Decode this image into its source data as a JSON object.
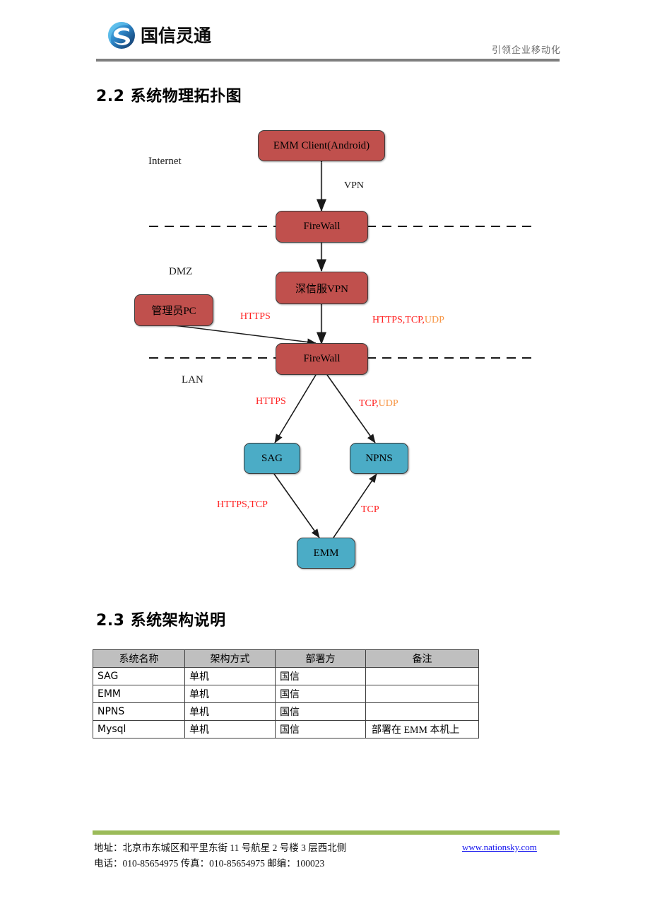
{
  "header": {
    "logo_text": "国信灵通",
    "logo_icon": "nationsky-swirl-logo-icon",
    "slogan": "引领企业移动化"
  },
  "sections": {
    "topology_heading": "2.2  系统物理拓扑图",
    "architecture_heading": "2.3  系统架构说明"
  },
  "diagram": {
    "nodes": [
      {
        "id": "emm-client",
        "label": "EMM Client(Android)",
        "color": "#c0504d"
      },
      {
        "id": "firewall-top",
        "label": "FireWall",
        "color": "#c0504d"
      },
      {
        "id": "sangfor-vpn",
        "label": "深信服VPN",
        "color": "#c0504d"
      },
      {
        "id": "admin-pc",
        "label": "管理员PC",
        "color": "#c0504d"
      },
      {
        "id": "firewall-bottom",
        "label": "FireWall",
        "color": "#c0504d"
      },
      {
        "id": "sag",
        "label": "SAG",
        "color": "#4bacc6"
      },
      {
        "id": "npns",
        "label": "NPNS",
        "color": "#4bacc6"
      },
      {
        "id": "emm",
        "label": "EMM",
        "color": "#4bacc6"
      }
    ],
    "zones": [
      {
        "id": "internet",
        "label": "Internet"
      },
      {
        "id": "dmz",
        "label": "DMZ"
      },
      {
        "id": "lan",
        "label": "LAN"
      }
    ],
    "edge_labels": [
      {
        "id": "vpn",
        "text": "VPN",
        "color": "#1a1a1a"
      },
      {
        "id": "https-admin",
        "text": "HTTPS",
        "color": "#ff2020"
      },
      {
        "id": "https-tcp",
        "text": "HTTPS,TCP,",
        "color": "#ff2020"
      },
      {
        "id": "udp-suffix-1",
        "text": "UDP",
        "color": "#f79646"
      },
      {
        "id": "https-sag",
        "text": "HTTPS",
        "color": "#ff2020"
      },
      {
        "id": "tcp-npns",
        "text": "TCP,",
        "color": "#ff2020"
      },
      {
        "id": "udp-suffix-2",
        "text": "UDP",
        "color": "#f79646"
      },
      {
        "id": "https-tcp-emm",
        "text": "HTTPS,TCP",
        "color": "#ff2020"
      },
      {
        "id": "tcp-emm",
        "text": "TCP",
        "color": "#ff2020"
      }
    ]
  },
  "table": {
    "headers": [
      "系统名称",
      "架构方式",
      "部署方",
      "备注"
    ],
    "rows": [
      {
        "name": "SAG",
        "arch": "单机",
        "deployer": "国信",
        "note": ""
      },
      {
        "name": "EMM",
        "arch": "单机",
        "deployer": "国信",
        "note": ""
      },
      {
        "name": "NPNS",
        "arch": "单机",
        "deployer": "国信",
        "note": ""
      },
      {
        "name": "Mysql",
        "arch": "单机",
        "deployer": "国信",
        "note": "部署在 EMM 本机上"
      }
    ]
  },
  "footer": {
    "address_line": "地址：北京市东城区和平里东街 11 号航星 2 号楼 3 层西北侧",
    "contact_line": "电话：010-85654975   传真：010-85654975  邮编：100023",
    "website": "www.nationsky.com"
  }
}
